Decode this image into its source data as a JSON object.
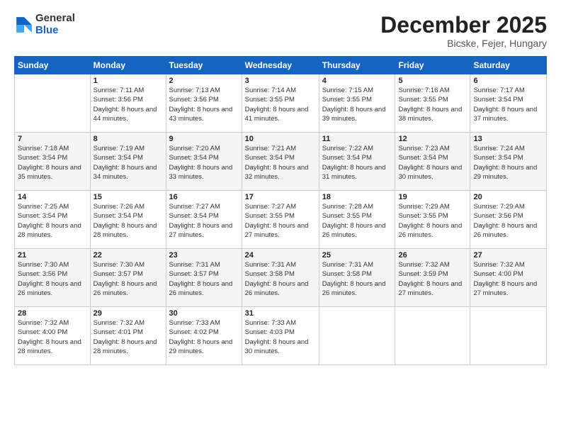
{
  "logo": {
    "general": "General",
    "blue": "Blue"
  },
  "header": {
    "month": "December 2025",
    "location": "Bicske, Fejer, Hungary"
  },
  "weekdays": [
    "Sunday",
    "Monday",
    "Tuesday",
    "Wednesday",
    "Thursday",
    "Friday",
    "Saturday"
  ],
  "weeks": [
    [
      {
        "day": "",
        "sunrise": "",
        "sunset": "",
        "daylight": ""
      },
      {
        "day": "1",
        "sunrise": "Sunrise: 7:11 AM",
        "sunset": "Sunset: 3:56 PM",
        "daylight": "Daylight: 8 hours and 44 minutes."
      },
      {
        "day": "2",
        "sunrise": "Sunrise: 7:13 AM",
        "sunset": "Sunset: 3:56 PM",
        "daylight": "Daylight: 8 hours and 43 minutes."
      },
      {
        "day": "3",
        "sunrise": "Sunrise: 7:14 AM",
        "sunset": "Sunset: 3:55 PM",
        "daylight": "Daylight: 8 hours and 41 minutes."
      },
      {
        "day": "4",
        "sunrise": "Sunrise: 7:15 AM",
        "sunset": "Sunset: 3:55 PM",
        "daylight": "Daylight: 8 hours and 39 minutes."
      },
      {
        "day": "5",
        "sunrise": "Sunrise: 7:16 AM",
        "sunset": "Sunset: 3:55 PM",
        "daylight": "Daylight: 8 hours and 38 minutes."
      },
      {
        "day": "6",
        "sunrise": "Sunrise: 7:17 AM",
        "sunset": "Sunset: 3:54 PM",
        "daylight": "Daylight: 8 hours and 37 minutes."
      }
    ],
    [
      {
        "day": "7",
        "sunrise": "Sunrise: 7:18 AM",
        "sunset": "Sunset: 3:54 PM",
        "daylight": "Daylight: 8 hours and 35 minutes."
      },
      {
        "day": "8",
        "sunrise": "Sunrise: 7:19 AM",
        "sunset": "Sunset: 3:54 PM",
        "daylight": "Daylight: 8 hours and 34 minutes."
      },
      {
        "day": "9",
        "sunrise": "Sunrise: 7:20 AM",
        "sunset": "Sunset: 3:54 PM",
        "daylight": "Daylight: 8 hours and 33 minutes."
      },
      {
        "day": "10",
        "sunrise": "Sunrise: 7:21 AM",
        "sunset": "Sunset: 3:54 PM",
        "daylight": "Daylight: 8 hours and 32 minutes."
      },
      {
        "day": "11",
        "sunrise": "Sunrise: 7:22 AM",
        "sunset": "Sunset: 3:54 PM",
        "daylight": "Daylight: 8 hours and 31 minutes."
      },
      {
        "day": "12",
        "sunrise": "Sunrise: 7:23 AM",
        "sunset": "Sunset: 3:54 PM",
        "daylight": "Daylight: 8 hours and 30 minutes."
      },
      {
        "day": "13",
        "sunrise": "Sunrise: 7:24 AM",
        "sunset": "Sunset: 3:54 PM",
        "daylight": "Daylight: 8 hours and 29 minutes."
      }
    ],
    [
      {
        "day": "14",
        "sunrise": "Sunrise: 7:25 AM",
        "sunset": "Sunset: 3:54 PM",
        "daylight": "Daylight: 8 hours and 28 minutes."
      },
      {
        "day": "15",
        "sunrise": "Sunrise: 7:26 AM",
        "sunset": "Sunset: 3:54 PM",
        "daylight": "Daylight: 8 hours and 28 minutes."
      },
      {
        "day": "16",
        "sunrise": "Sunrise: 7:27 AM",
        "sunset": "Sunset: 3:54 PM",
        "daylight": "Daylight: 8 hours and 27 minutes."
      },
      {
        "day": "17",
        "sunrise": "Sunrise: 7:27 AM",
        "sunset": "Sunset: 3:55 PM",
        "daylight": "Daylight: 8 hours and 27 minutes."
      },
      {
        "day": "18",
        "sunrise": "Sunrise: 7:28 AM",
        "sunset": "Sunset: 3:55 PM",
        "daylight": "Daylight: 8 hours and 26 minutes."
      },
      {
        "day": "19",
        "sunrise": "Sunrise: 7:29 AM",
        "sunset": "Sunset: 3:55 PM",
        "daylight": "Daylight: 8 hours and 26 minutes."
      },
      {
        "day": "20",
        "sunrise": "Sunrise: 7:29 AM",
        "sunset": "Sunset: 3:56 PM",
        "daylight": "Daylight: 8 hours and 26 minutes."
      }
    ],
    [
      {
        "day": "21",
        "sunrise": "Sunrise: 7:30 AM",
        "sunset": "Sunset: 3:56 PM",
        "daylight": "Daylight: 8 hours and 26 minutes."
      },
      {
        "day": "22",
        "sunrise": "Sunrise: 7:30 AM",
        "sunset": "Sunset: 3:57 PM",
        "daylight": "Daylight: 8 hours and 26 minutes."
      },
      {
        "day": "23",
        "sunrise": "Sunrise: 7:31 AM",
        "sunset": "Sunset: 3:57 PM",
        "daylight": "Daylight: 8 hours and 26 minutes."
      },
      {
        "day": "24",
        "sunrise": "Sunrise: 7:31 AM",
        "sunset": "Sunset: 3:58 PM",
        "daylight": "Daylight: 8 hours and 26 minutes."
      },
      {
        "day": "25",
        "sunrise": "Sunrise: 7:31 AM",
        "sunset": "Sunset: 3:58 PM",
        "daylight": "Daylight: 8 hours and 26 minutes."
      },
      {
        "day": "26",
        "sunrise": "Sunrise: 7:32 AM",
        "sunset": "Sunset: 3:59 PM",
        "daylight": "Daylight: 8 hours and 27 minutes."
      },
      {
        "day": "27",
        "sunrise": "Sunrise: 7:32 AM",
        "sunset": "Sunset: 4:00 PM",
        "daylight": "Daylight: 8 hours and 27 minutes."
      }
    ],
    [
      {
        "day": "28",
        "sunrise": "Sunrise: 7:32 AM",
        "sunset": "Sunset: 4:00 PM",
        "daylight": "Daylight: 8 hours and 28 minutes."
      },
      {
        "day": "29",
        "sunrise": "Sunrise: 7:32 AM",
        "sunset": "Sunset: 4:01 PM",
        "daylight": "Daylight: 8 hours and 28 minutes."
      },
      {
        "day": "30",
        "sunrise": "Sunrise: 7:33 AM",
        "sunset": "Sunset: 4:02 PM",
        "daylight": "Daylight: 8 hours and 29 minutes."
      },
      {
        "day": "31",
        "sunrise": "Sunrise: 7:33 AM",
        "sunset": "Sunset: 4:03 PM",
        "daylight": "Daylight: 8 hours and 30 minutes."
      },
      {
        "day": "",
        "sunrise": "",
        "sunset": "",
        "daylight": ""
      },
      {
        "day": "",
        "sunrise": "",
        "sunset": "",
        "daylight": ""
      },
      {
        "day": "",
        "sunrise": "",
        "sunset": "",
        "daylight": ""
      }
    ]
  ]
}
